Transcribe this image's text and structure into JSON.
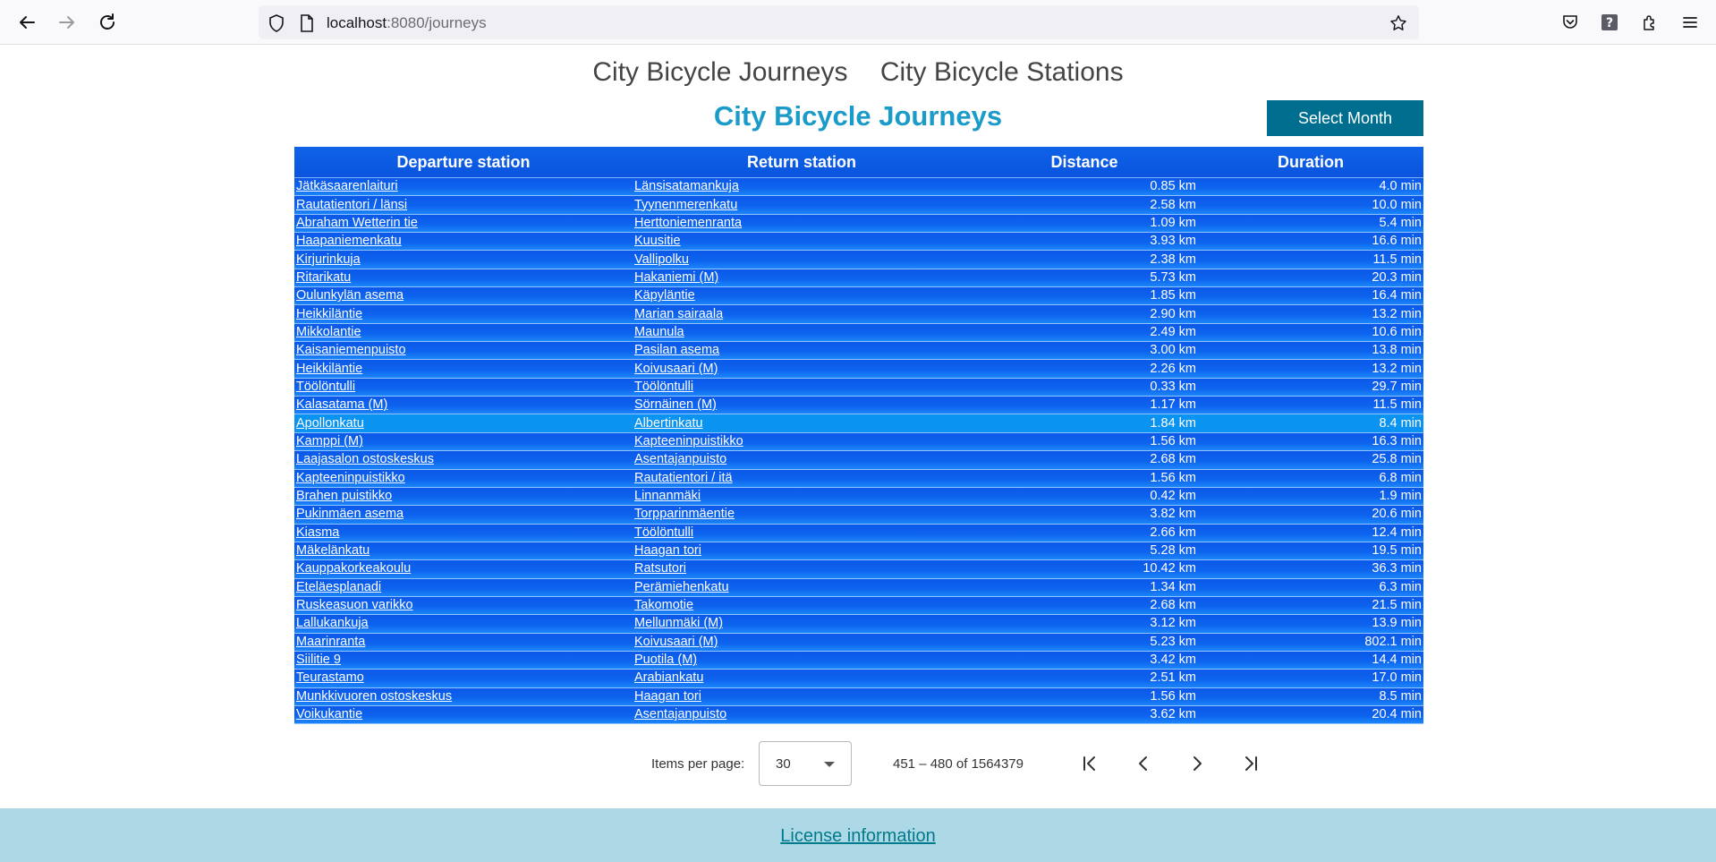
{
  "browser": {
    "url_host": "localhost",
    "url_rest": ":8080/journeys"
  },
  "nav": {
    "journeys_link": "City Bicycle Journeys",
    "stations_link": "City Bicycle Stations"
  },
  "page": {
    "title": "City Bicycle Journeys",
    "select_month_label": "Select Month"
  },
  "table": {
    "headers": [
      "Departure station",
      "Return station",
      "Distance",
      "Duration"
    ],
    "highlighted_row": 13,
    "rows": [
      [
        "Jätkäsaarenlaituri",
        "Länsisatamankuja",
        "0.85 km",
        "4.0 min"
      ],
      [
        "Rautatientori / länsi",
        "Tyynenmerenkatu",
        "2.58 km",
        "10.0 min"
      ],
      [
        "Abraham Wetterin tie",
        "Herttoniemenranta",
        "1.09 km",
        "5.4 min"
      ],
      [
        "Haapaniemenkatu",
        "Kuusitie",
        "3.93 km",
        "16.6 min"
      ],
      [
        "Kirjurinkuja",
        "Vallipolku",
        "2.38 km",
        "11.5 min"
      ],
      [
        "Ritarikatu",
        "Hakaniemi (M)",
        "5.73 km",
        "20.3 min"
      ],
      [
        "Oulunkylän asema",
        "Käpyläntie",
        "1.85 km",
        "16.4 min"
      ],
      [
        "Heikkiläntie",
        "Marian sairaala",
        "2.90 km",
        "13.2 min"
      ],
      [
        "Mikkolantie",
        "Maunula",
        "2.49 km",
        "10.6 min"
      ],
      [
        "Kaisaniemenpuisto",
        "Pasilan asema",
        "3.00 km",
        "13.8 min"
      ],
      [
        "Heikkiläntie",
        "Koivusaari (M)",
        "2.26 km",
        "13.2 min"
      ],
      [
        "Töölöntulli",
        "Töölöntulli",
        "0.33 km",
        "29.7 min"
      ],
      [
        "Kalasatama (M)",
        "Sörnäinen (M)",
        "1.17 km",
        "11.5 min"
      ],
      [
        "Apollonkatu",
        "Albertinkatu",
        "1.84 km",
        "8.4 min"
      ],
      [
        "Kamppi (M)",
        "Kapteeninpuistikko",
        "1.56 km",
        "16.3 min"
      ],
      [
        "Laajasalon ostoskeskus",
        "Asentajanpuisto",
        "2.68 km",
        "25.8 min"
      ],
      [
        "Kapteeninpuistikko",
        "Rautatientori / itä",
        "1.56 km",
        "6.8 min"
      ],
      [
        "Brahen puistikko",
        "Linnanmäki",
        "0.42 km",
        "1.9 min"
      ],
      [
        "Pukinmäen asema",
        "Torpparinmäentie",
        "3.82 km",
        "20.6 min"
      ],
      [
        "Kiasma",
        "Töölöntulli",
        "2.66 km",
        "12.4 min"
      ],
      [
        "Mäkelänkatu",
        "Haagan tori",
        "5.28 km",
        "19.5 min"
      ],
      [
        "Kauppakorkeakoulu",
        "Ratsutori",
        "10.42 km",
        "36.3 min"
      ],
      [
        "Eteläesplanadi",
        "Perämiehenkatu",
        "1.34 km",
        "6.3 min"
      ],
      [
        "Ruskeasuon varikko",
        "Takomotie",
        "2.68 km",
        "21.5 min"
      ],
      [
        "Lallukankuja",
        "Mellunmäki (M)",
        "3.12 km",
        "13.9 min"
      ],
      [
        "Maarinranta",
        "Koivusaari (M)",
        "5.23 km",
        "802.1 min"
      ],
      [
        "Siilitie 9",
        "Puotila (M)",
        "3.42 km",
        "14.4 min"
      ],
      [
        "Teurastamo",
        "Arabiankatu",
        "2.51 km",
        "17.0 min"
      ],
      [
        "Munkkivuoren ostoskeskus",
        "Haagan tori",
        "1.56 km",
        "8.5 min"
      ],
      [
        "Voikukantie",
        "Asentajanpuisto",
        "3.62 km",
        "20.4 min"
      ]
    ]
  },
  "paginator": {
    "items_per_page_label": "Items per page:",
    "items_per_page_value": "30",
    "range_label": "451 – 480 of 1564379"
  },
  "footer": {
    "license_link": "License information"
  },
  "colors": {
    "title": "#1a9bc9",
    "button": "#006e8f",
    "table_blue": "#0b4ed9",
    "footer": "#add8e6"
  }
}
